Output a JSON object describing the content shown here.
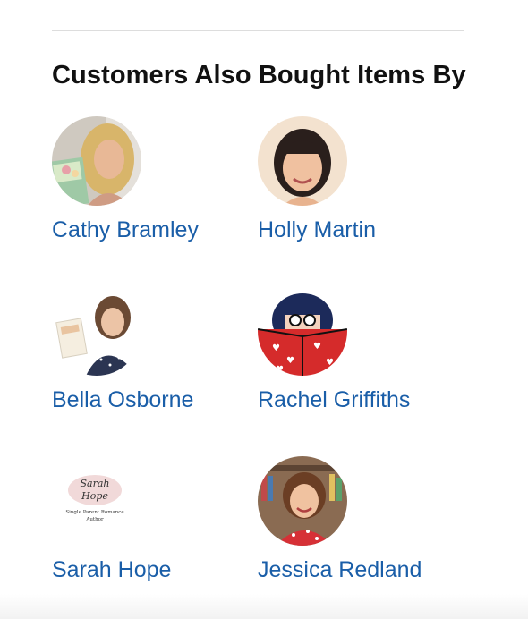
{
  "section": {
    "title": "Customers Also Bought Items By"
  },
  "authors": [
    {
      "name": "Cathy Bramley",
      "avatar": "author-photo"
    },
    {
      "name": "Holly Martin",
      "avatar": "author-photo"
    },
    {
      "name": "Bella Osborne",
      "avatar": "author-photo"
    },
    {
      "name": "Rachel Griffiths",
      "avatar": "illustration-reading-book"
    },
    {
      "name": "Sarah Hope",
      "avatar": "logo",
      "logo_text": [
        "Sarah",
        "Hope",
        "Single Parent Romance",
        "Author"
      ]
    },
    {
      "name": "Jessica Redland",
      "avatar": "author-photo"
    }
  ],
  "colors": {
    "link": "#1a5ea8",
    "heading": "#111111",
    "divider": "#dddddd"
  }
}
